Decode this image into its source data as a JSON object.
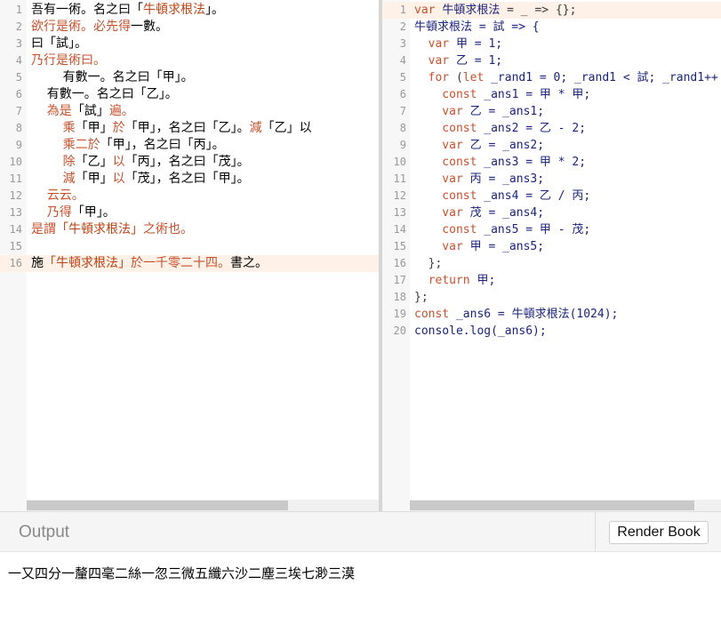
{
  "editor_left": {
    "active_line": 15,
    "lines": [
      {
        "num": "1",
        "tokens": [
          {
            "t": "吾有一術。名之曰",
            "c": "plain"
          },
          {
            "t": "「",
            "c": "plain"
          },
          {
            "t": "牛頓求根法",
            "c": "str"
          },
          {
            "t": "」。",
            "c": "plain"
          }
        ]
      },
      {
        "num": "2",
        "tokens": [
          {
            "t": "欲行是術。必先得",
            "c": "kw"
          },
          {
            "t": "一數。",
            "c": "plain"
          }
        ]
      },
      {
        "num": "3",
        "tokens": [
          {
            "t": "曰「試」。",
            "c": "plain"
          }
        ]
      },
      {
        "num": "4",
        "tokens": [
          {
            "t": "乃行是術曰。",
            "c": "kw"
          }
        ]
      },
      {
        "num": "5",
        "tokens": [
          {
            "t": "\t\t有數一。名之曰「甲」。",
            "c": "plain"
          }
        ]
      },
      {
        "num": "6",
        "tokens": [
          {
            "t": "\t有數一。名之曰「乙」。",
            "c": "plain"
          }
        ]
      },
      {
        "num": "7",
        "tokens": [
          {
            "t": "\t為是",
            "c": "kw"
          },
          {
            "t": "「試」",
            "c": "plain"
          },
          {
            "t": "遍。",
            "c": "kw"
          }
        ]
      },
      {
        "num": "8",
        "tokens": [
          {
            "t": "\t\t乘",
            "c": "kw"
          },
          {
            "t": "「甲」",
            "c": "plain"
          },
          {
            "t": "於",
            "c": "kw"
          },
          {
            "t": "「甲」，名之曰「乙」。",
            "c": "plain"
          },
          {
            "t": "減",
            "c": "kw"
          },
          {
            "t": "「乙」以",
            "c": "plain"
          }
        ]
      },
      {
        "num": "9",
        "tokens": [
          {
            "t": "\t\t乘二於",
            "c": "kw"
          },
          {
            "t": "「甲」，名之曰「丙」。",
            "c": "plain"
          }
        ]
      },
      {
        "num": "10",
        "tokens": [
          {
            "t": "\t\t除",
            "c": "kw"
          },
          {
            "t": "「乙」",
            "c": "plain"
          },
          {
            "t": "以",
            "c": "kw"
          },
          {
            "t": "「丙」，名之曰「茂」。",
            "c": "plain"
          }
        ]
      },
      {
        "num": "11",
        "tokens": [
          {
            "t": "\t\t減",
            "c": "kw"
          },
          {
            "t": "「甲」",
            "c": "plain"
          },
          {
            "t": "以",
            "c": "kw"
          },
          {
            "t": "「茂」，名之曰「甲」。",
            "c": "plain"
          }
        ]
      },
      {
        "num": "12",
        "tokens": [
          {
            "t": "\t云云。",
            "c": "kw"
          }
        ]
      },
      {
        "num": "13",
        "tokens": [
          {
            "t": "\t乃得",
            "c": "kw"
          },
          {
            "t": "「甲」。",
            "c": "plain"
          }
        ]
      },
      {
        "num": "14",
        "tokens": [
          {
            "t": "是謂",
            "c": "kw"
          },
          {
            "t": "「牛頓求根法」",
            "c": "str"
          },
          {
            "t": "之術也。",
            "c": "kw"
          }
        ]
      },
      {
        "num": "15",
        "tokens": []
      },
      {
        "num": "16",
        "tokens": [
          {
            "t": "施",
            "c": "plain"
          },
          {
            "t": "「牛頓求根法」",
            "c": "str"
          },
          {
            "t": "於一千零二十四。",
            "c": "kw"
          },
          {
            "t": "書之。",
            "c": "plain"
          }
        ]
      }
    ]
  },
  "editor_right": {
    "active_line": 0,
    "lines": [
      {
        "num": "1",
        "tokens": [
          {
            "t": "var ",
            "c": "kw"
          },
          {
            "t": "牛頓求根法",
            "c": "ident"
          },
          {
            "t": " = _ => {};",
            "c": "op"
          }
        ]
      },
      {
        "num": "2",
        "tokens": [
          {
            "t": "牛頓求根法 = 試 => {",
            "c": "ident"
          }
        ]
      },
      {
        "num": "3",
        "tokens": [
          {
            "t": "  var ",
            "c": "kw"
          },
          {
            "t": "甲 = 1;",
            "c": "ident"
          }
        ]
      },
      {
        "num": "4",
        "tokens": [
          {
            "t": "  var ",
            "c": "kw"
          },
          {
            "t": "乙 = 1;",
            "c": "ident"
          }
        ]
      },
      {
        "num": "5",
        "tokens": [
          {
            "t": "  for ",
            "c": "kw"
          },
          {
            "t": "(",
            "c": "op"
          },
          {
            "t": "let ",
            "c": "kw"
          },
          {
            "t": "_rand1 = 0; _rand1 < 試; _rand1++",
            "c": "ident"
          }
        ]
      },
      {
        "num": "6",
        "tokens": [
          {
            "t": "    const ",
            "c": "kw"
          },
          {
            "t": "_ans1 = 甲 * 甲;",
            "c": "ident"
          }
        ]
      },
      {
        "num": "7",
        "tokens": [
          {
            "t": "    var ",
            "c": "kw"
          },
          {
            "t": "乙 = _ans1;",
            "c": "ident"
          }
        ]
      },
      {
        "num": "8",
        "tokens": [
          {
            "t": "    const ",
            "c": "kw"
          },
          {
            "t": "_ans2 = 乙 - 2;",
            "c": "ident"
          }
        ]
      },
      {
        "num": "9",
        "tokens": [
          {
            "t": "    var ",
            "c": "kw"
          },
          {
            "t": "乙 = _ans2;",
            "c": "ident"
          }
        ]
      },
      {
        "num": "10",
        "tokens": [
          {
            "t": "    const ",
            "c": "kw"
          },
          {
            "t": "_ans3 = 甲 * 2;",
            "c": "ident"
          }
        ]
      },
      {
        "num": "11",
        "tokens": [
          {
            "t": "    var ",
            "c": "kw"
          },
          {
            "t": "丙 = _ans3;",
            "c": "ident"
          }
        ]
      },
      {
        "num": "12",
        "tokens": [
          {
            "t": "    const ",
            "c": "kw"
          },
          {
            "t": "_ans4 = 乙 / 丙;",
            "c": "ident"
          }
        ]
      },
      {
        "num": "13",
        "tokens": [
          {
            "t": "    var ",
            "c": "kw"
          },
          {
            "t": "茂 = _ans4;",
            "c": "ident"
          }
        ]
      },
      {
        "num": "14",
        "tokens": [
          {
            "t": "    const ",
            "c": "kw"
          },
          {
            "t": "_ans5 = 甲 - 茂;",
            "c": "ident"
          }
        ]
      },
      {
        "num": "15",
        "tokens": [
          {
            "t": "    var ",
            "c": "kw"
          },
          {
            "t": "甲 = _ans5;",
            "c": "ident"
          }
        ]
      },
      {
        "num": "16",
        "tokens": [
          {
            "t": "  };",
            "c": "op"
          }
        ]
      },
      {
        "num": "17",
        "tokens": [
          {
            "t": "  return ",
            "c": "kw"
          },
          {
            "t": "甲;",
            "c": "ident"
          }
        ]
      },
      {
        "num": "18",
        "tokens": [
          {
            "t": "};",
            "c": "op"
          }
        ]
      },
      {
        "num": "19",
        "tokens": [
          {
            "t": "const ",
            "c": "kw"
          },
          {
            "t": "_ans6 = 牛頓求根法(1024);",
            "c": "ident"
          }
        ]
      },
      {
        "num": "20",
        "tokens": [
          {
            "t": "console.log(_ans6);",
            "c": "ident"
          }
        ]
      }
    ]
  },
  "output": {
    "title": "Output",
    "render_button_label": "Render Book",
    "text": "一又四分一釐四毫二絲一忽三微五纖六沙二塵三埃七渺三漠"
  }
}
